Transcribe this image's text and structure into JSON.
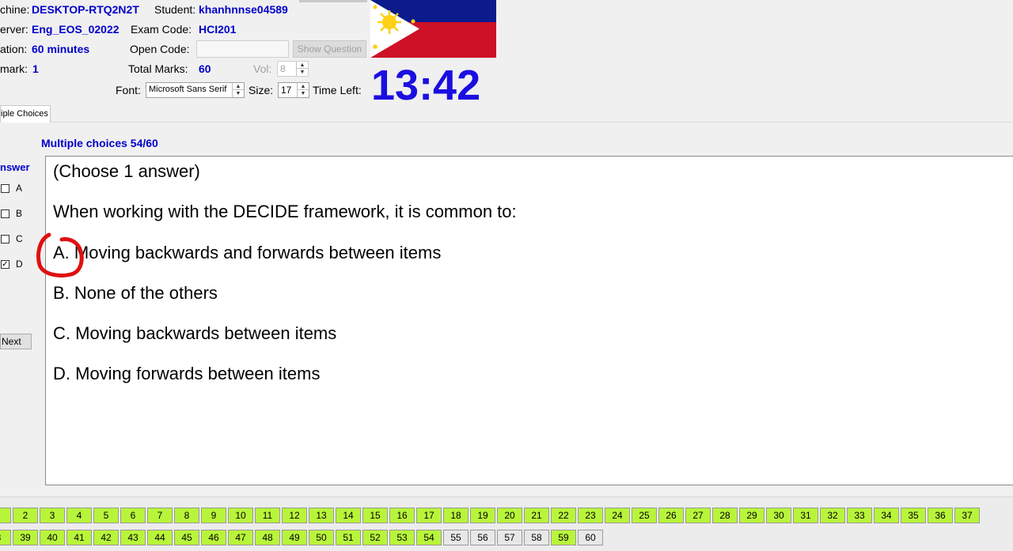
{
  "header": {
    "machine_label": "chine:",
    "machine_value": "DESKTOP-RTQ2N2T",
    "student_label": "Student:",
    "student_value": "khanhnnse04589",
    "server_label": "erver:",
    "server_value": "Eng_EOS_02022",
    "exam_code_label": "Exam Code:",
    "exam_code_value": "HCI201",
    "duration_label": "ation:",
    "duration_value": "60 minutes",
    "open_code_label": "Open Code:",
    "open_code_value": "",
    "show_question_label": "Show Question",
    "mark_label": "mark:",
    "mark_value": "1",
    "total_marks_label": "Total Marks:",
    "total_marks_value": "60",
    "vol_label": "Vol:",
    "vol_value": "8",
    "font_label": "Font:",
    "font_value": "Microsoft Sans Serif",
    "size_label": "Size:",
    "size_value": "17",
    "time_left_label": "Time Left:",
    "timer": "13:42"
  },
  "flag": {
    "top_color": "#0b1b8c",
    "bottom_color": "#ce1126",
    "triangle_color": "#ffffff",
    "sun_color": "#fcd116"
  },
  "tab": {
    "label": "iple Choices"
  },
  "question": {
    "progress": "Multiple choices 54/60",
    "instruction": "(Choose 1 answer)",
    "stem": "When working with the DECIDE framework, it is common to:",
    "options": [
      {
        "label": "A.  Moving backwards and forwards between items"
      },
      {
        "label": "B.  None of the others"
      },
      {
        "label": "C.  Moving backwards between items"
      },
      {
        "label": "D.  Moving forwards between items"
      }
    ]
  },
  "answer_panel": {
    "title": "nswer",
    "choices": [
      {
        "letter": "A",
        "checked": false
      },
      {
        "letter": "B",
        "checked": false
      },
      {
        "letter": "C",
        "checked": false
      },
      {
        "letter": "D",
        "checked": true
      }
    ],
    "next_label": "Next"
  },
  "nav": {
    "row1": [
      {
        "n": "",
        "answered": true
      },
      {
        "n": "2",
        "answered": true
      },
      {
        "n": "3",
        "answered": true
      },
      {
        "n": "4",
        "answered": true
      },
      {
        "n": "5",
        "answered": true
      },
      {
        "n": "6",
        "answered": true
      },
      {
        "n": "7",
        "answered": true
      },
      {
        "n": "8",
        "answered": true
      },
      {
        "n": "9",
        "answered": true
      },
      {
        "n": "10",
        "answered": true
      },
      {
        "n": "11",
        "answered": true
      },
      {
        "n": "12",
        "answered": true
      },
      {
        "n": "13",
        "answered": true
      },
      {
        "n": "14",
        "answered": true
      },
      {
        "n": "15",
        "answered": true
      },
      {
        "n": "16",
        "answered": true
      },
      {
        "n": "17",
        "answered": true
      },
      {
        "n": "18",
        "answered": true
      },
      {
        "n": "19",
        "answered": true
      },
      {
        "n": "20",
        "answered": true
      },
      {
        "n": "21",
        "answered": true
      },
      {
        "n": "22",
        "answered": true
      },
      {
        "n": "23",
        "answered": true
      },
      {
        "n": "24",
        "answered": true
      },
      {
        "n": "25",
        "answered": true
      },
      {
        "n": "26",
        "answered": true
      },
      {
        "n": "27",
        "answered": true
      },
      {
        "n": "28",
        "answered": true
      },
      {
        "n": "29",
        "answered": true
      },
      {
        "n": "30",
        "answered": true
      },
      {
        "n": "31",
        "answered": true
      },
      {
        "n": "32",
        "answered": true
      },
      {
        "n": "33",
        "answered": true
      },
      {
        "n": "34",
        "answered": true
      },
      {
        "n": "35",
        "answered": true
      },
      {
        "n": "36",
        "answered": true
      },
      {
        "n": "37",
        "answered": true
      }
    ],
    "row2": [
      {
        "n": "8",
        "answered": true
      },
      {
        "n": "39",
        "answered": true
      },
      {
        "n": "40",
        "answered": true
      },
      {
        "n": "41",
        "answered": true
      },
      {
        "n": "42",
        "answered": true
      },
      {
        "n": "43",
        "answered": true
      },
      {
        "n": "44",
        "answered": true
      },
      {
        "n": "45",
        "answered": true
      },
      {
        "n": "46",
        "answered": true
      },
      {
        "n": "47",
        "answered": true
      },
      {
        "n": "48",
        "answered": true
      },
      {
        "n": "49",
        "answered": true
      },
      {
        "n": "50",
        "answered": true
      },
      {
        "n": "51",
        "answered": true
      },
      {
        "n": "52",
        "answered": true
      },
      {
        "n": "53",
        "answered": true
      },
      {
        "n": "54",
        "answered": true
      },
      {
        "n": "55",
        "answered": false
      },
      {
        "n": "56",
        "answered": false
      },
      {
        "n": "57",
        "answered": false
      },
      {
        "n": "58",
        "answered": false
      },
      {
        "n": "59",
        "answered": true
      },
      {
        "n": "60",
        "answered": false
      }
    ],
    "answered_color": "#b8f53a",
    "unanswered_color": "#e8e8e8"
  }
}
